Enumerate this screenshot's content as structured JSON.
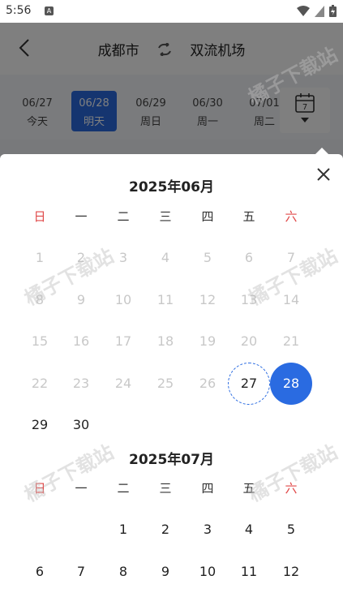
{
  "status_bar": {
    "time": "5:56",
    "notification_badge": "A"
  },
  "header": {
    "origin": "成都市",
    "destination": "双流机场"
  },
  "date_strip": [
    {
      "date": "06/27",
      "label": "今天",
      "active": false
    },
    {
      "date": "06/28",
      "label": "明天",
      "active": true
    },
    {
      "date": "06/29",
      "label": "周日",
      "active": false
    },
    {
      "date": "06/30",
      "label": "周一",
      "active": false
    },
    {
      "date": "07/01",
      "label": "周二",
      "active": false
    }
  ],
  "calendar_button": {
    "day": "7"
  },
  "weekdays": [
    "日",
    "一",
    "二",
    "三",
    "四",
    "五",
    "六"
  ],
  "months": [
    {
      "title": "2025年06月",
      "days": [
        "1",
        "2",
        "3",
        "4",
        "5",
        "6",
        "7",
        "8",
        "9",
        "10",
        "11",
        "12",
        "13",
        "14",
        "15",
        "16",
        "17",
        "18",
        "19",
        "20",
        "21",
        "22",
        "23",
        "24",
        "25",
        "26",
        "27",
        "28",
        "29",
        "30"
      ],
      "first_weekday": 0,
      "today": "27",
      "selected": "28"
    },
    {
      "title": "2025年07月",
      "days": [
        "1",
        "2",
        "3",
        "4",
        "5",
        "6",
        "7",
        "8",
        "9",
        "10",
        "11",
        "12"
      ],
      "first_weekday": 2
    }
  ],
  "watermark": "橘子下载站",
  "colors": {
    "accent": "#2a6be1",
    "weekend": "#e04848",
    "disabled": "#c8c8c8"
  }
}
